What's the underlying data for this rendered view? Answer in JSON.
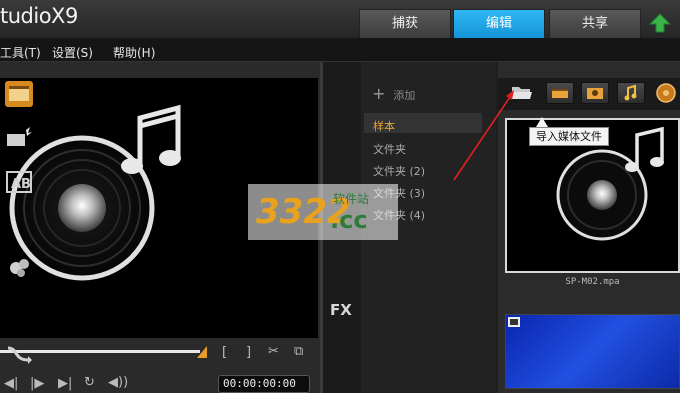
{
  "app": {
    "title": "tudioX9"
  },
  "tabs": [
    {
      "label": "捕获"
    },
    {
      "label": "编辑"
    },
    {
      "label": "共享"
    }
  ],
  "menu": [
    {
      "label": "工具(T)"
    },
    {
      "label": "设置(S)"
    },
    {
      "label": "帮助(H)"
    }
  ],
  "preview": {
    "timecode": "00:00:00:00",
    "trim_start": "[",
    "trim_end": "]",
    "scrub_position": 1.0
  },
  "folders": {
    "add_label": "添加",
    "items": [
      {
        "label": "样本",
        "selected": true
      },
      {
        "label": "文件夹"
      },
      {
        "label": "文件夹 (2)"
      },
      {
        "label": "文件夹 (3)"
      },
      {
        "label": "文件夹 (4)"
      }
    ]
  },
  "library": {
    "tooltip": "导入媒体文件",
    "thumb1_label": "SP-M02.mpa"
  },
  "watermark": {
    "logo": "3322",
    "text": "软件站",
    "domain": ".cc"
  },
  "colors": {
    "active_tab": "#1a9fe2",
    "accent_orange": "#e59a2b",
    "selected_folder": "#e8a33a",
    "upload_green": "#3bb54a"
  },
  "icons": {
    "sidebar": [
      "media-icon",
      "transition-icon",
      "title-icon",
      "graphic-icon",
      "fx-icon",
      "path-icon"
    ],
    "library_toolbar": [
      "folder-open-icon",
      "video-filter-icon",
      "photo-filter-icon",
      "audio-filter-icon",
      "effects-icon"
    ]
  }
}
